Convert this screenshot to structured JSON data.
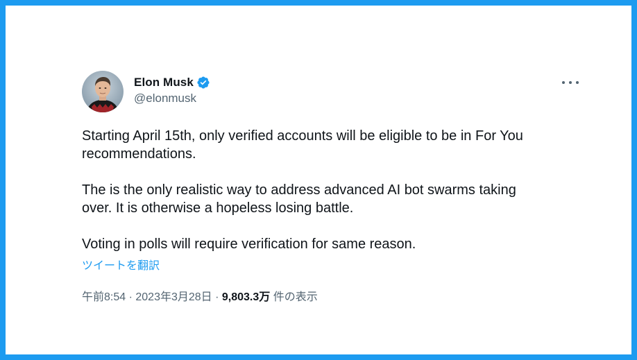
{
  "tweet": {
    "author": {
      "name": "Elon Musk",
      "handle": "@elonmusk",
      "verified": true,
      "verified_icon": "verified-badge-icon"
    },
    "more_icon": "more-dots-icon",
    "text": {
      "p1_line1": "Starting April 15th, only verified accounts will be eligible to be in For You",
      "p1_line2": "recommendations.",
      "p2_line1": "The is the only realistic way to address advanced AI bot swarms taking",
      "p2_line2": "over. It is otherwise a hopeless losing battle.",
      "p3_line1": "Voting in polls will require verification for same reason."
    },
    "translate_label": "ツイートを翻訳",
    "meta": {
      "time": "午前8:54",
      "separator": " · ",
      "date": "2023年3月28日",
      "views_count": "9,803.3万",
      "views_label": " 件の表示"
    }
  },
  "colors": {
    "frame_border": "#1d9bf0",
    "accent": "#1d9bf0",
    "text_primary": "#0f1419",
    "text_secondary": "#536471"
  }
}
